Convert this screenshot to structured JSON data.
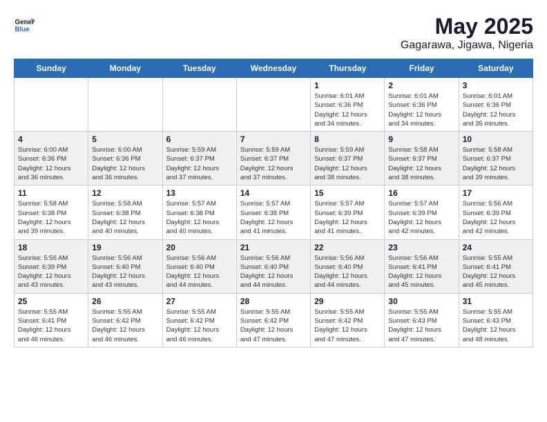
{
  "logo": {
    "text_general": "General",
    "text_blue": "Blue"
  },
  "title": "May 2025",
  "subtitle": "Gagarawa, Jigawa, Nigeria",
  "weekdays": [
    "Sunday",
    "Monday",
    "Tuesday",
    "Wednesday",
    "Thursday",
    "Friday",
    "Saturday"
  ],
  "weeks": [
    [
      {
        "day": "",
        "info": ""
      },
      {
        "day": "",
        "info": ""
      },
      {
        "day": "",
        "info": ""
      },
      {
        "day": "",
        "info": ""
      },
      {
        "day": "1",
        "info": "Sunrise: 6:01 AM\nSunset: 6:36 PM\nDaylight: 12 hours\nand 34 minutes."
      },
      {
        "day": "2",
        "info": "Sunrise: 6:01 AM\nSunset: 6:36 PM\nDaylight: 12 hours\nand 34 minutes."
      },
      {
        "day": "3",
        "info": "Sunrise: 6:01 AM\nSunset: 6:36 PM\nDaylight: 12 hours\nand 35 minutes."
      }
    ],
    [
      {
        "day": "4",
        "info": "Sunrise: 6:00 AM\nSunset: 6:36 PM\nDaylight: 12 hours\nand 36 minutes."
      },
      {
        "day": "5",
        "info": "Sunrise: 6:00 AM\nSunset: 6:36 PM\nDaylight: 12 hours\nand 36 minutes."
      },
      {
        "day": "6",
        "info": "Sunrise: 5:59 AM\nSunset: 6:37 PM\nDaylight: 12 hours\nand 37 minutes."
      },
      {
        "day": "7",
        "info": "Sunrise: 5:59 AM\nSunset: 6:37 PM\nDaylight: 12 hours\nand 37 minutes."
      },
      {
        "day": "8",
        "info": "Sunrise: 5:59 AM\nSunset: 6:37 PM\nDaylight: 12 hours\nand 38 minutes."
      },
      {
        "day": "9",
        "info": "Sunrise: 5:58 AM\nSunset: 6:37 PM\nDaylight: 12 hours\nand 38 minutes."
      },
      {
        "day": "10",
        "info": "Sunrise: 5:58 AM\nSunset: 6:37 PM\nDaylight: 12 hours\nand 39 minutes."
      }
    ],
    [
      {
        "day": "11",
        "info": "Sunrise: 5:58 AM\nSunset: 6:38 PM\nDaylight: 12 hours\nand 39 minutes."
      },
      {
        "day": "12",
        "info": "Sunrise: 5:58 AM\nSunset: 6:38 PM\nDaylight: 12 hours\nand 40 minutes."
      },
      {
        "day": "13",
        "info": "Sunrise: 5:57 AM\nSunset: 6:38 PM\nDaylight: 12 hours\nand 40 minutes."
      },
      {
        "day": "14",
        "info": "Sunrise: 5:57 AM\nSunset: 6:38 PM\nDaylight: 12 hours\nand 41 minutes."
      },
      {
        "day": "15",
        "info": "Sunrise: 5:57 AM\nSunset: 6:39 PM\nDaylight: 12 hours\nand 41 minutes."
      },
      {
        "day": "16",
        "info": "Sunrise: 5:57 AM\nSunset: 6:39 PM\nDaylight: 12 hours\nand 42 minutes."
      },
      {
        "day": "17",
        "info": "Sunrise: 5:56 AM\nSunset: 6:39 PM\nDaylight: 12 hours\nand 42 minutes."
      }
    ],
    [
      {
        "day": "18",
        "info": "Sunrise: 5:56 AM\nSunset: 6:39 PM\nDaylight: 12 hours\nand 43 minutes."
      },
      {
        "day": "19",
        "info": "Sunrise: 5:56 AM\nSunset: 6:40 PM\nDaylight: 12 hours\nand 43 minutes."
      },
      {
        "day": "20",
        "info": "Sunrise: 5:56 AM\nSunset: 6:40 PM\nDaylight: 12 hours\nand 44 minutes."
      },
      {
        "day": "21",
        "info": "Sunrise: 5:56 AM\nSunset: 6:40 PM\nDaylight: 12 hours\nand 44 minutes."
      },
      {
        "day": "22",
        "info": "Sunrise: 5:56 AM\nSunset: 6:40 PM\nDaylight: 12 hours\nand 44 minutes."
      },
      {
        "day": "23",
        "info": "Sunrise: 5:56 AM\nSunset: 6:41 PM\nDaylight: 12 hours\nand 45 minutes."
      },
      {
        "day": "24",
        "info": "Sunrise: 5:55 AM\nSunset: 6:41 PM\nDaylight: 12 hours\nand 45 minutes."
      }
    ],
    [
      {
        "day": "25",
        "info": "Sunrise: 5:55 AM\nSunset: 6:41 PM\nDaylight: 12 hours\nand 46 minutes."
      },
      {
        "day": "26",
        "info": "Sunrise: 5:55 AM\nSunset: 6:42 PM\nDaylight: 12 hours\nand 46 minutes."
      },
      {
        "day": "27",
        "info": "Sunrise: 5:55 AM\nSunset: 6:42 PM\nDaylight: 12 hours\nand 46 minutes."
      },
      {
        "day": "28",
        "info": "Sunrise: 5:55 AM\nSunset: 6:42 PM\nDaylight: 12 hours\nand 47 minutes."
      },
      {
        "day": "29",
        "info": "Sunrise: 5:55 AM\nSunset: 6:42 PM\nDaylight: 12 hours\nand 47 minutes."
      },
      {
        "day": "30",
        "info": "Sunrise: 5:55 AM\nSunset: 6:43 PM\nDaylight: 12 hours\nand 47 minutes."
      },
      {
        "day": "31",
        "info": "Sunrise: 5:55 AM\nSunset: 6:43 PM\nDaylight: 12 hours\nand 48 minutes."
      }
    ]
  ]
}
